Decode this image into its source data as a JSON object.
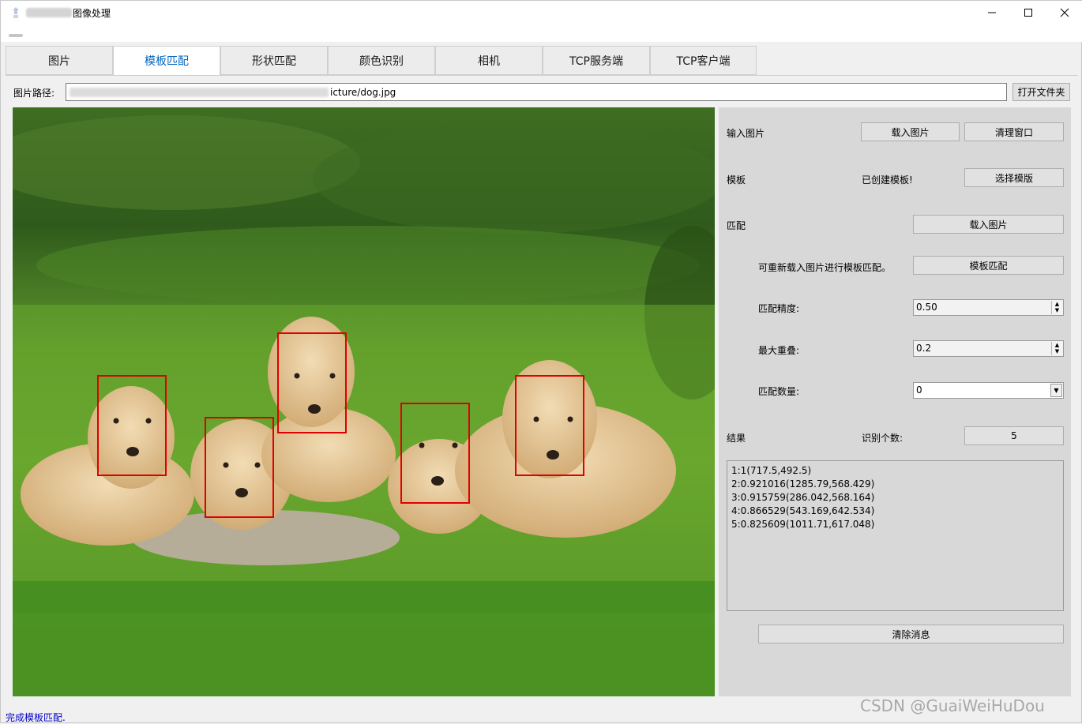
{
  "window": {
    "title": "图像处理"
  },
  "controls": {
    "minimize": "minimize",
    "maximize": "maximize",
    "close": "close"
  },
  "tabs": [
    {
      "label": "图片",
      "active": false
    },
    {
      "label": "模板匹配",
      "active": true
    },
    {
      "label": "形状匹配",
      "active": false
    },
    {
      "label": "颜色识别",
      "active": false
    },
    {
      "label": "相机",
      "active": false
    },
    {
      "label": "TCP服务端",
      "active": false
    },
    {
      "label": "TCP客户端",
      "active": false
    }
  ],
  "path": {
    "label": "图片路径:",
    "value_visible": "icture/dog.jpg",
    "open_button": "打开文件夹"
  },
  "panel": {
    "input_label": "输入图片",
    "load_image_button": "载入图片",
    "clear_window_button": "清理窗口",
    "template_label": "模板",
    "template_status": "已创建模板!",
    "select_template_button": "选择模版",
    "match_label": "匹配",
    "match_load_button": "载入图片",
    "reload_hint": "可重新载入图片进行模板匹配。",
    "template_match_button": "模板匹配",
    "precision_label": "匹配精度:",
    "precision_value": "0.50",
    "overlap_label": "最大重叠:",
    "overlap_value": "0.2",
    "count_label": "匹配数量:",
    "count_value": "0",
    "result_label": "结果",
    "found_label": "识别个数:",
    "found_value": "5",
    "results": [
      "1:1(717.5,492.5)",
      "2:0.921016(1285.79,568.429)",
      "3:0.915759(286.042,568.164)",
      "4:0.866529(543.169,642.534)",
      "5:0.825609(1011.71,617.048)"
    ],
    "clear_messages_button": "清除消息"
  },
  "status": {
    "text": "完成模板匹配."
  },
  "watermark": "CSDN @GuaiWeiHuDou",
  "colors": {
    "accent": "#0067c0",
    "match_box": "#e00000",
    "status_text": "#0000c8"
  }
}
